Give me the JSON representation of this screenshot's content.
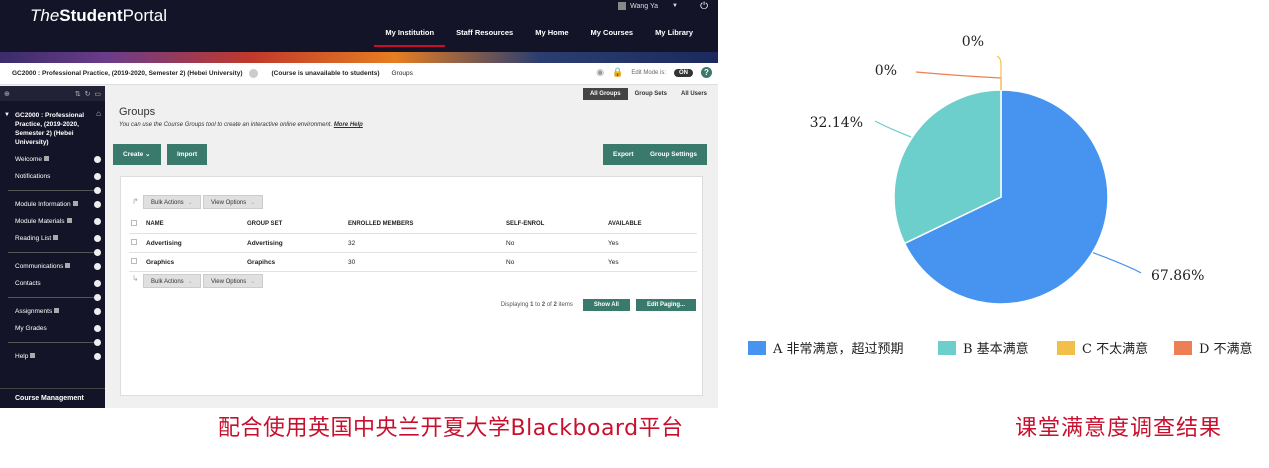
{
  "header": {
    "logo_italic": "The",
    "logo_bold": "Student",
    "logo_rest": "Portal",
    "user_name": "Wang Ya",
    "nav": [
      "My Institution",
      "Staff Resources",
      "My Home",
      "My Courses",
      "My Library"
    ]
  },
  "course_bar": {
    "course_name": "GC2000 : Professional Practice, (2019-2020, Semester 2) (Hebei University)",
    "unavailable": "(Course is unavailable to students)",
    "breadcrumb": "Groups",
    "edit_mode_label": "Edit Mode is:",
    "edit_mode_value": "ON",
    "help": "?"
  },
  "sidebar": {
    "course_title": "GC2000 : Professional Practice, (2019-2020, Semester 2) (Hebei University)",
    "items": [
      "Welcome",
      "Notifications",
      "Module Information",
      "Module Materials",
      "Reading List",
      "Communications",
      "Contacts",
      "Assignments",
      "My Grades",
      "Help"
    ],
    "bottom": "Course Management"
  },
  "main": {
    "tabs": [
      "All Groups",
      "Group Sets",
      "All Users"
    ],
    "title": "Groups",
    "description": "You can use the Course Groups tool to create an interactive online environment.",
    "more_help": "More Help",
    "create": "Create",
    "import": "Import",
    "export": "Export",
    "group_settings": "Group Settings",
    "bulk_actions": "Bulk Actions",
    "view_options": "View Options",
    "columns": [
      "NAME",
      "GROUP SET",
      "ENROLLED MEMBERS",
      "SELF-ENROL",
      "AVAILABLE"
    ],
    "rows": [
      [
        "Advertising",
        "Advertising",
        "32",
        "No",
        "Yes"
      ],
      [
        "Graphics",
        "Grapihcs",
        "30",
        "No",
        "Yes"
      ]
    ],
    "displaying": "Displaying",
    "disp_from": "1",
    "disp_to": "to",
    "disp_n": "2",
    "disp_of": "of",
    "disp_total": "2",
    "disp_items": "items",
    "show_all": "Show All",
    "edit_paging": "Edit Paging..."
  },
  "captions": {
    "left": "配合使用英国中央兰开夏大学Blackboard平台",
    "right": "课堂满意度调查结果"
  },
  "chart_data": {
    "type": "pie",
    "categories": [
      "A 非常满意，超过预期",
      "B 基本满意",
      "C 不太满意",
      "D 不满意"
    ],
    "values": [
      67.86,
      32.14,
      0,
      0
    ],
    "data_labels": [
      "67.86%",
      "32.14%",
      "0%",
      "0%"
    ],
    "colors": [
      "#4694f0",
      "#6ccfcb",
      "#f2c04a",
      "#ee7f55"
    ],
    "legend_position": "bottom"
  }
}
